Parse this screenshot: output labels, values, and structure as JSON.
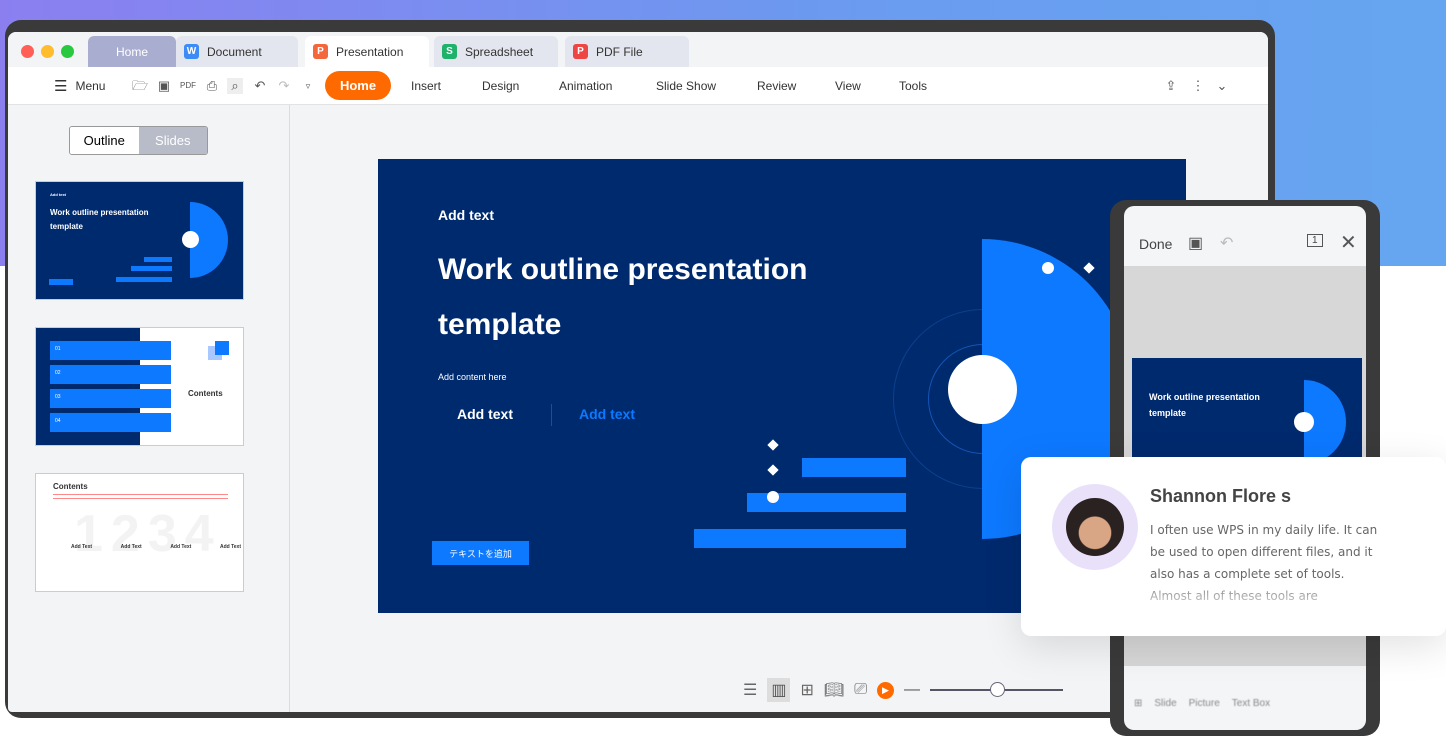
{
  "tabs": [
    {
      "label": "Home"
    },
    {
      "label": "Document",
      "icon": "W",
      "color": "#3b8cf5"
    },
    {
      "label": "Presentation",
      "icon": "P",
      "color": "#f4663b"
    },
    {
      "label": "Spreadsheet",
      "icon": "S",
      "color": "#1fb26b"
    },
    {
      "label": "PDF File",
      "icon": "P",
      "color": "#ee4545"
    }
  ],
  "toolbar": {
    "menu": "Menu",
    "home": "Home",
    "items": [
      "Insert",
      "Design",
      "Animation",
      "Slide Show",
      "Review",
      "View",
      "Tools"
    ]
  },
  "panel": {
    "outline": "Outline",
    "slides": "Slides"
  },
  "thumbs": {
    "t2_title": "Contents",
    "t2_nums": [
      "01",
      "02",
      "03",
      "04"
    ],
    "t3_title": "Contents",
    "t3_digits": "1234",
    "t3_items": [
      "Add Text",
      "Add Text",
      "Add Text",
      "Add Text"
    ]
  },
  "slide": {
    "kicker": "Add text",
    "title1": "Work outline presentation",
    "title2": "template",
    "content": "Add content here",
    "addtext1": "Add text",
    "addtext2": "Add text",
    "button": "テキストを追加"
  },
  "zoom_slider": 0.5,
  "accent": "#ff6a00",
  "phone": {
    "done": "Done",
    "tools": [
      "Slide",
      "Picture",
      "Text Box"
    ]
  },
  "review": {
    "name": "Shannon Flore s",
    "text": "I often use WPS in my daily life. It can be used to open different files, and it also has a complete set of tools. Almost all of these tools are"
  }
}
